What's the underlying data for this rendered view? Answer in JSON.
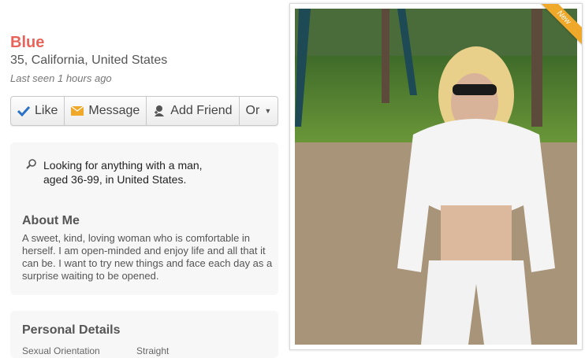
{
  "profile": {
    "name": "Blue",
    "location": "35, California, United States",
    "last_seen": "Last seen 1 hours ago"
  },
  "actions": {
    "like": "Like",
    "message": "Message",
    "add_friend": "Add Friend",
    "or": "Or"
  },
  "looking_for": {
    "icon": "search-icon",
    "line1": "Looking for anything with a man,",
    "line2": "aged 36-99, in United States."
  },
  "about": {
    "heading": "About Me",
    "text": "A sweet, kind, loving woman who is comfortable in herself. I am open-minded and enjoy life and all that it can be. I want to try new things and face each day as a surprise waiting to be opened."
  },
  "personal_details": {
    "heading": "Personal Details",
    "rows": [
      {
        "key": "Sexual Orientation",
        "value": "Straight"
      }
    ]
  },
  "photo": {
    "badge": "New"
  },
  "colors": {
    "name": "#e8645a",
    "like_check": "#2a72c8",
    "message_icon": "#f0a82a",
    "badge": "#f0a82a"
  }
}
